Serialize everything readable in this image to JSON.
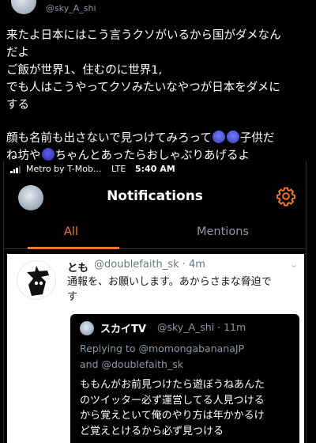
{
  "outer_tweet": {
    "handle": "@sky_A_shi",
    "name": "スカイTV",
    "lines": [
      "来たよ日本にはこう言うクソがいるから国がダメなん",
      "だよ",
      "ご飯が世界1、住むのに世界1,",
      "でも人はこうやってクソみたいなやつが日本をダメに",
      "する"
    ],
    "line2_before_emoji": "顔も名前も出さないで見つけてみろって",
    "line2_after_emoji": "子供だ",
    "line3_before_emoji": "ね坊や",
    "line3_after_emoji": "ちゃんとあったらおしゃぶりあげるよ"
  },
  "status_bar": {
    "carrier": "Metro by T-Mob...",
    "network": "LTE",
    "time": "5:40 AM"
  },
  "notifications": {
    "title": "Notifications",
    "tabs": [
      "All",
      "Mentions"
    ]
  },
  "mention_tweet": {
    "name": "とも",
    "handle_time": "@doublefaith_sk · 4m",
    "text_line1": "通報を、お願いします。あからさまな脅迫で",
    "text_line2": "す",
    "quote": {
      "name": "スカイTV",
      "handle_time": "@sky_A_shi · 11m",
      "replying_line1": "Replying to @momongabananaJP",
      "replying_line2": "and @doublefaith_sk",
      "text_lines": [
        "ももんがお前見つけたら遊ぼうねあんた",
        "のツイッター必ず運営してる人見つける",
        "から覚えといて俺のやり方は年かかるけ",
        "ど覚えとけるから必ず見つける"
      ]
    }
  },
  "colors": {
    "accent": "#f4782c",
    "muted": "#8899a6"
  }
}
